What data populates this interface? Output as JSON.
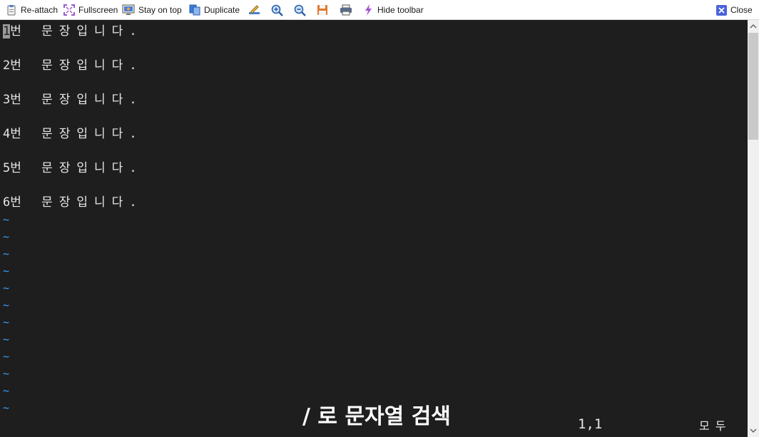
{
  "toolbar": {
    "items": [
      {
        "label": "Re-attach",
        "icon": "clipboard-icon"
      },
      {
        "label": "Fullscreen",
        "icon": "fullscreen-icon"
      },
      {
        "label": "Stay on top",
        "icon": "monitor-icon"
      },
      {
        "label": "Duplicate",
        "icon": "duplicate-icon"
      },
      {
        "label": "",
        "icon": "edit-icon"
      },
      {
        "label": "",
        "icon": "zoom-in-icon"
      },
      {
        "label": "",
        "icon": "zoom-out-icon"
      },
      {
        "label": "",
        "icon": "save-icon"
      },
      {
        "label": "",
        "icon": "print-icon"
      },
      {
        "label": "Hide toolbar",
        "icon": "lightning-icon"
      }
    ],
    "close_label": "Close"
  },
  "editor": {
    "lines": [
      {
        "num": "1",
        "text": "번 문장입니다."
      },
      {
        "num": "2",
        "text": "번 문장입니다."
      },
      {
        "num": "3",
        "text": "번 문장입니다."
      },
      {
        "num": "4",
        "text": "번 문장입니다."
      },
      {
        "num": "5",
        "text": "번 문장입니다."
      },
      {
        "num": "6",
        "text": "번 문장입니다."
      }
    ],
    "empty_line_marker": "~",
    "empty_line_count": 12,
    "cursor_position": "1,1",
    "scroll_status": "모두"
  },
  "caption": {
    "text": "/ 로 문자열 검색"
  },
  "colors": {
    "background": "#1e1e1e",
    "text": "#e6e6e6",
    "tilde": "#3aa0ff",
    "cursor": "#9a9a9a"
  }
}
